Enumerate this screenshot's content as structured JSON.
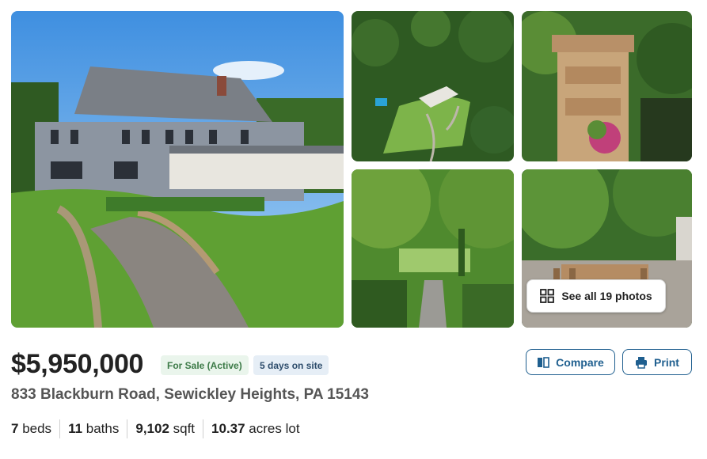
{
  "gallery": {
    "photos": [
      {
        "icon": "house-exterior-photo"
      },
      {
        "icon": "aerial-estate-photo"
      },
      {
        "icon": "stone-gate-pillar-photo"
      },
      {
        "icon": "garden-allee-photo"
      },
      {
        "icon": "patio-dining-photo"
      }
    ],
    "see_all_label": "See all 19 photos",
    "see_all_icon": "grid-icon"
  },
  "listing": {
    "price": "$5,950,000",
    "status_badge": "For Sale (Active)",
    "days_badge": "5 days on site",
    "address": "833 Blackburn Road, Sewickley Heights, PA 15143",
    "facts": [
      {
        "value": "7",
        "label": " beds"
      },
      {
        "value": "11",
        "label": " baths"
      },
      {
        "value": "9,102",
        "label": " sqft"
      },
      {
        "value": "10.37",
        "label": " acres lot"
      }
    ]
  },
  "actions": {
    "compare_label": "Compare",
    "print_label": "Print"
  },
  "colors": {
    "accent": "#1f5f8f",
    "sale_badge_bg": "#eaf5ec",
    "sale_badge_text": "#3c7a47",
    "days_badge_bg": "#e6eef6",
    "days_badge_text": "#2d4c6b"
  }
}
